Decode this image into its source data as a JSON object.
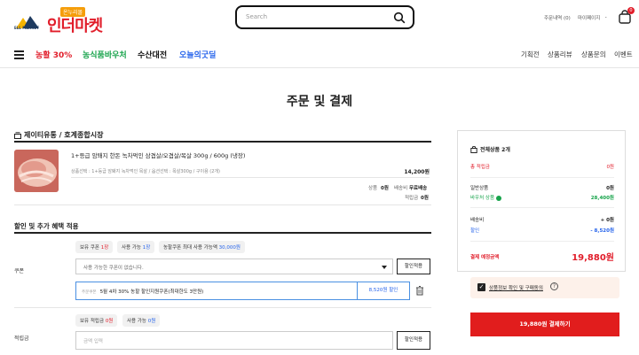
{
  "header": {
    "logo_badge": "온누리몰",
    "logo_name": "인더마켓",
    "logo_sub": "ELL MARKET",
    "search_placeholder": "Search",
    "order_history": "주문내역 (0)",
    "my_page": "마이페이지",
    "cart_count": "0"
  },
  "nav": {
    "left": [
      {
        "label": "농활 30%",
        "color": "#e11d2a"
      },
      {
        "label": "농식품바우처",
        "color": "#16a34a"
      },
      {
        "label": "수산대전",
        "color": "#111111"
      },
      {
        "label": "오늘의굿딜",
        "color": "#2563eb"
      }
    ],
    "right": [
      "기획전",
      "상품리뷰",
      "상품문의",
      "이벤트"
    ]
  },
  "page_title": "주문 및 결제",
  "seller": "제이티유통 / 호계종합시장",
  "product": {
    "name": "1+등급 암퇘지 한돈 녹차먹인 삼겹살/오겹살/목살 300g / 600g (냉장)",
    "option": "상품선택 : 1+등급 암퇘지 녹차먹인 목살 / 옵션선택 : 목살300g / 구이용 (2개)",
    "price": "14,200원",
    "shipping_label": "상품",
    "shipping_value": "0원",
    "delivery_label": "배송비",
    "delivery_value": "무료배송",
    "points_label": "적립금",
    "points_value": "0원"
  },
  "discount": {
    "title": "할인 및 추가 혜택 적용",
    "coupon_label": "쿠폰",
    "chips": [
      {
        "prefix": "보유 쿠폰",
        "value": "1장",
        "tone": "red"
      },
      {
        "prefix": "사용 가능",
        "value": "1장",
        "tone": "blue"
      },
      {
        "prefix": "농할쿠폰 최대 사용 가능액",
        "value": "30,000원",
        "tone": "blue"
      }
    ],
    "coupon_select": "사용 가능한 쿠폰이 없습니다.",
    "apply_coupon": "할인적용",
    "applied_prefix": "주문쿠폰",
    "applied_coupon": "5월 4차 30% 농할 할인지원쿠폰(최대한도 3만원)",
    "applied_discount": "8,520원 할인",
    "points_label": "적립금",
    "points_chips": [
      {
        "prefix": "보유 적립금",
        "value": "0원",
        "tone": "red"
      },
      {
        "prefix": "사용 가능",
        "value": "0원",
        "tone": "blue"
      }
    ],
    "points_placeholder": "금액 입력",
    "apply_points": "할인적용"
  },
  "summary": {
    "total_products": "전체상품 2개",
    "total_points_label": "총 적립금",
    "total_points": "0원",
    "general_label": "일반상품",
    "general_value": "0원",
    "voucher_label": "바우처 상품",
    "voucher_value": "28,400원",
    "shipping_label": "배송비",
    "shipping_value": "+ 0원",
    "discount_label": "할인",
    "discount_value": "- 8,520원",
    "final_label": "결제 예정금액",
    "final_value": "19,880원",
    "agree_text": "상품정보 확인 및 구매동의",
    "pay_button": "19,880원 결제하기"
  }
}
